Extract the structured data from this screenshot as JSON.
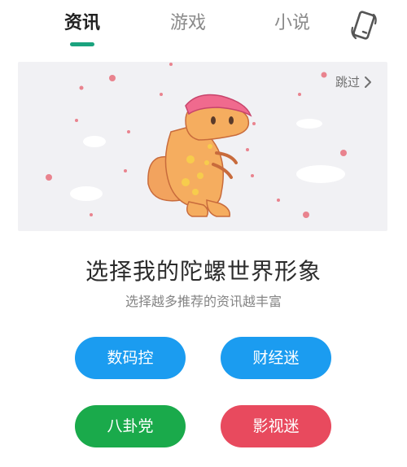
{
  "tabs": [
    {
      "label": "资讯",
      "active": true
    },
    {
      "label": "游戏",
      "active": false
    },
    {
      "label": "小说",
      "active": false
    }
  ],
  "accent_color": "#1aa37e",
  "banner": {
    "skip_label": "跳过",
    "illustration": "dinosaur-parasaurolophus"
  },
  "headline": "选择我的陀螺世界形象",
  "subline": "选择越多推荐的资讯越丰富",
  "options": [
    {
      "label": "数码控",
      "color": "#1b9cf0"
    },
    {
      "label": "财经迷",
      "color": "#1b9cf0"
    },
    {
      "label": "八卦党",
      "color": "#1aaa4b"
    },
    {
      "label": "影视迷",
      "color": "#e84a5e"
    }
  ]
}
